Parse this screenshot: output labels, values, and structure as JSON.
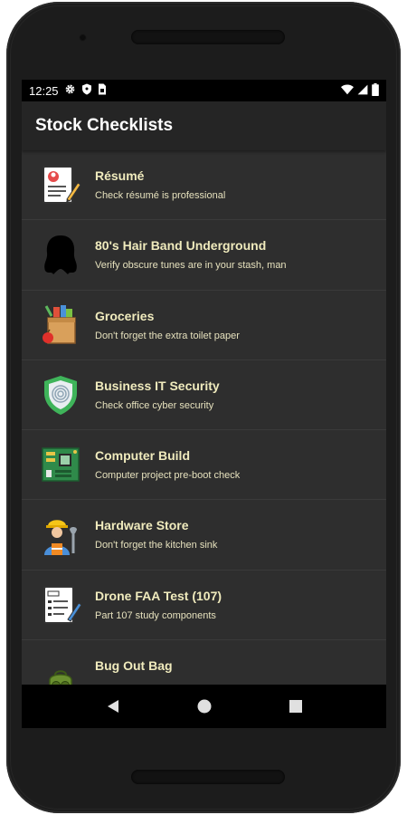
{
  "status_bar": {
    "time": "12:25",
    "icons": [
      "settings-gear-icon",
      "shield-icon",
      "sim-card-icon"
    ],
    "right_icons": [
      "wifi-icon",
      "signal-icon",
      "battery-icon"
    ]
  },
  "app_bar": {
    "title": "Stock Checklists"
  },
  "checklists": [
    {
      "title": "Résumé",
      "subtitle": "Check résumé is professional",
      "icon": "resume-document-icon"
    },
    {
      "title": "80's Hair Band Underground",
      "subtitle": "Verify obscure tunes are in your stash, man",
      "icon": "hair-silhouette-icon"
    },
    {
      "title": "Groceries",
      "subtitle": "Don't forget the extra toilet paper",
      "icon": "grocery-bag-icon"
    },
    {
      "title": "Business IT Security",
      "subtitle": "Check office cyber security",
      "icon": "security-shield-icon"
    },
    {
      "title": "Computer Build",
      "subtitle": "Computer project pre-boot check",
      "icon": "circuit-board-icon"
    },
    {
      "title": "Hardware Store",
      "subtitle": "Don't forget the kitchen sink",
      "icon": "worker-wrench-icon"
    },
    {
      "title": "Drone FAA Test (107)",
      "subtitle": "Part 107 study components",
      "icon": "faa-form-icon"
    },
    {
      "title": "Bug Out Bag",
      "subtitle": "",
      "icon": "backpack-icon"
    }
  ],
  "nav_bar": {
    "buttons": [
      "back-icon",
      "home-icon",
      "recents-icon"
    ]
  }
}
